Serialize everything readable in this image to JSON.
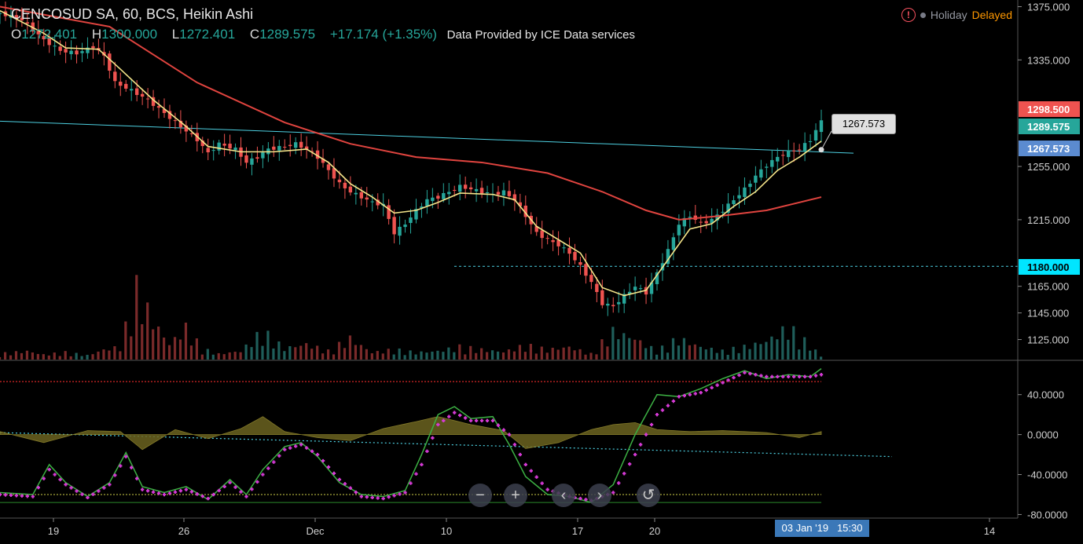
{
  "header": {
    "title": "CENCOSUD SA, 60, BCS, Heikin Ashi",
    "ohlc": [
      {
        "k": "O",
        "v": "1272.401"
      },
      {
        "k": "H",
        "v": "1300.000"
      },
      {
        "k": "L",
        "v": "1272.401"
      },
      {
        "k": "C",
        "v": "1289.575"
      }
    ],
    "change": "+17.174 (+1.35%)",
    "provider": "Data Provided by ICE Data services",
    "status_holiday": "Holiday",
    "status_delayed": "Delayed"
  },
  "tooltip": "1267.573",
  "crosshair_date": "03 Jan '19",
  "crosshair_time": "15:30",
  "controls": {
    "zoom_out": "−",
    "zoom_in": "+",
    "back": "‹",
    "forward": "›",
    "reset": "↺"
  },
  "colors": {
    "up": "#26a69a",
    "down": "#ef5350",
    "sma_fast": "#f5e58a",
    "sma_slow": "#e0443f",
    "trend": "#4dd0e1",
    "stoch_k": "#3cb043",
    "stoch_d": "#d63ad6",
    "histogram": "#6b6320"
  },
  "chart_data": [
    {
      "type": "candlestick",
      "title": "CENCOSUD SA, 60, BCS, Heikin Ashi",
      "x_ticks": [
        "19",
        "26",
        "Dec",
        "10",
        "17",
        "20",
        "14"
      ],
      "y_ticks": [
        "1375.000",
        "1335.000",
        "1255.000",
        "1215.000",
        "1165.000",
        "1145.000",
        "1125.000"
      ],
      "ylim": [
        1110,
        1380
      ],
      "price_labels": [
        {
          "value": "1298.500",
          "color": "#ef5350"
        },
        {
          "value": "1289.575",
          "color": "#26a69a"
        },
        {
          "value": "1267.573",
          "color": "#5b8bd0"
        },
        {
          "value": "1180.000",
          "color": "#00e5ff"
        }
      ],
      "horizontal_line": 1180,
      "trendline": {
        "from": 1289,
        "to": 1265
      },
      "price_path": [
        [
          0,
          1370
        ],
        [
          4,
          1365
        ],
        [
          8,
          1350
        ],
        [
          11,
          1342
        ],
        [
          14,
          1340
        ],
        [
          17,
          1345
        ],
        [
          19,
          1338
        ],
        [
          21,
          1318
        ],
        [
          24,
          1312
        ],
        [
          27,
          1305
        ],
        [
          30,
          1295
        ],
        [
          33,
          1285
        ],
        [
          36,
          1275
        ],
        [
          38,
          1265
        ],
        [
          40,
          1272
        ],
        [
          43,
          1268
        ],
        [
          45,
          1258
        ],
        [
          47,
          1262
        ],
        [
          49,
          1268
        ],
        [
          52,
          1270
        ],
        [
          54,
          1272
        ],
        [
          56,
          1268
        ],
        [
          58,
          1262
        ],
        [
          60,
          1252
        ],
        [
          62,
          1242
        ],
        [
          64,
          1236
        ],
        [
          66,
          1232
        ],
        [
          68,
          1228
        ],
        [
          70,
          1226
        ],
        [
          72,
          1205
        ],
        [
          74,
          1212
        ],
        [
          76,
          1222
        ],
        [
          78,
          1230
        ],
        [
          80,
          1232
        ],
        [
          82,
          1236
        ],
        [
          84,
          1240
        ],
        [
          86,
          1238
        ],
        [
          88,
          1236
        ],
        [
          90,
          1234
        ],
        [
          92,
          1236
        ],
        [
          94,
          1230
        ],
        [
          96,
          1218
        ],
        [
          98,
          1205
        ],
        [
          100,
          1200
        ],
        [
          102,
          1196
        ],
        [
          104,
          1190
        ],
        [
          106,
          1180
        ],
        [
          108,
          1168
        ],
        [
          110,
          1152
        ],
        [
          112,
          1150
        ],
        [
          114,
          1158
        ],
        [
          116,
          1165
        ],
        [
          118,
          1160
        ],
        [
          120,
          1175
        ],
        [
          122,
          1192
        ],
        [
          124,
          1212
        ],
        [
          126,
          1218
        ],
        [
          128,
          1212
        ],
        [
          130,
          1215
        ],
        [
          132,
          1222
        ],
        [
          134,
          1230
        ],
        [
          136,
          1238
        ],
        [
          138,
          1248
        ],
        [
          140,
          1256
        ],
        [
          142,
          1262
        ],
        [
          144,
          1266
        ],
        [
          146,
          1268
        ],
        [
          148,
          1275
        ],
        [
          150,
          1289
        ]
      ],
      "sma_fast": [
        [
          0,
          1372
        ],
        [
          8,
          1355
        ],
        [
          12,
          1344
        ],
        [
          18,
          1343
        ],
        [
          22,
          1328
        ],
        [
          28,
          1305
        ],
        [
          34,
          1285
        ],
        [
          38,
          1270
        ],
        [
          44,
          1266
        ],
        [
          50,
          1266
        ],
        [
          56,
          1268
        ],
        [
          60,
          1258
        ],
        [
          64,
          1242
        ],
        [
          68,
          1232
        ],
        [
          72,
          1220
        ],
        [
          76,
          1222
        ],
        [
          80,
          1228
        ],
        [
          84,
          1235
        ],
        [
          90,
          1234
        ],
        [
          94,
          1230
        ],
        [
          98,
          1210
        ],
        [
          102,
          1200
        ],
        [
          106,
          1190
        ],
        [
          110,
          1164
        ],
        [
          114,
          1158
        ],
        [
          118,
          1162
        ],
        [
          122,
          1185
        ],
        [
          126,
          1208
        ],
        [
          130,
          1212
        ],
        [
          134,
          1225
        ],
        [
          138,
          1236
        ],
        [
          142,
          1252
        ],
        [
          146,
          1262
        ],
        [
          150,
          1274
        ]
      ],
      "sma_slow": [
        [
          0,
          1375
        ],
        [
          20,
          1360
        ],
        [
          36,
          1318
        ],
        [
          52,
          1288
        ],
        [
          64,
          1272
        ],
        [
          76,
          1262
        ],
        [
          88,
          1258
        ],
        [
          100,
          1250
        ],
        [
          110,
          1236
        ],
        [
          118,
          1222
        ],
        [
          124,
          1215
        ],
        [
          132,
          1218
        ],
        [
          140,
          1222
        ],
        [
          150,
          1232
        ]
      ],
      "volume": [
        [
          0,
          0.08
        ],
        [
          5,
          0.12
        ],
        [
          8,
          0.07
        ],
        [
          12,
          0.1
        ],
        [
          16,
          0.06
        ],
        [
          19,
          0.14
        ],
        [
          22,
          0.18
        ],
        [
          25,
          1.0
        ],
        [
          28,
          0.55
        ],
        [
          31,
          0.22
        ],
        [
          34,
          0.45
        ],
        [
          37,
          0.15
        ],
        [
          40,
          0.08
        ],
        [
          44,
          0.12
        ],
        [
          48,
          0.4
        ],
        [
          52,
          0.16
        ],
        [
          56,
          0.22
        ],
        [
          60,
          0.12
        ],
        [
          64,
          0.3
        ],
        [
          68,
          0.1
        ],
        [
          72,
          0.14
        ],
        [
          76,
          0.1
        ],
        [
          80,
          0.12
        ],
        [
          84,
          0.18
        ],
        [
          88,
          0.14
        ],
        [
          92,
          0.11
        ],
        [
          96,
          0.2
        ],
        [
          100,
          0.14
        ],
        [
          104,
          0.18
        ],
        [
          108,
          0.08
        ],
        [
          112,
          0.4
        ],
        [
          116,
          0.3
        ],
        [
          120,
          0.12
        ],
        [
          124,
          0.3
        ],
        [
          128,
          0.18
        ],
        [
          132,
          0.12
        ],
        [
          136,
          0.18
        ],
        [
          140,
          0.26
        ],
        [
          144,
          0.46
        ],
        [
          148,
          0.2
        ],
        [
          150,
          0.05
        ]
      ]
    },
    {
      "type": "line",
      "title": "",
      "y_ticks": [
        "40.0000",
        "0.0000",
        "-40.0000",
        "-80.0000"
      ],
      "ylim": [
        -82,
        72
      ],
      "levels": {
        "upper": 53,
        "zero": 0,
        "lower": -60
      },
      "series": [
        {
          "values": [
            [
              0,
              -58
            ],
            [
              6,
              -60
            ],
            [
              9,
              -30
            ],
            [
              12,
              -48
            ],
            [
              16,
              -62
            ],
            [
              20,
              -48
            ],
            [
              23,
              -18
            ],
            [
              26,
              -52
            ],
            [
              30,
              -58
            ],
            [
              34,
              -52
            ],
            [
              38,
              -65
            ],
            [
              42,
              -45
            ],
            [
              45,
              -60
            ],
            [
              48,
              -35
            ],
            [
              52,
              -12
            ],
            [
              55,
              -8
            ],
            [
              58,
              -22
            ],
            [
              62,
              -48
            ],
            [
              66,
              -60
            ],
            [
              70,
              -62
            ],
            [
              74,
              -56
            ],
            [
              77,
              -20
            ],
            [
              80,
              20
            ],
            [
              83,
              28
            ],
            [
              86,
              16
            ],
            [
              90,
              18
            ],
            [
              93,
              -10
            ],
            [
              96,
              -42
            ],
            [
              100,
              -60
            ],
            [
              104,
              -62
            ],
            [
              108,
              -68
            ],
            [
              112,
              -50
            ],
            [
              116,
              0
            ],
            [
              120,
              40
            ],
            [
              124,
              38
            ],
            [
              128,
              46
            ],
            [
              132,
              56
            ],
            [
              136,
              64
            ],
            [
              140,
              56
            ],
            [
              144,
              60
            ],
            [
              148,
              58
            ],
            [
              150,
              66
            ]
          ]
        },
        {
          "values": [
            [
              0,
              -60
            ],
            [
              6,
              -62
            ],
            [
              9,
              -35
            ],
            [
              12,
              -50
            ],
            [
              16,
              -63
            ],
            [
              20,
              -50
            ],
            [
              23,
              -22
            ],
            [
              26,
              -55
            ],
            [
              30,
              -60
            ],
            [
              34,
              -55
            ],
            [
              38,
              -64
            ],
            [
              42,
              -48
            ],
            [
              45,
              -62
            ],
            [
              48,
              -40
            ],
            [
              52,
              -15
            ],
            [
              55,
              -10
            ],
            [
              58,
              -20
            ],
            [
              62,
              -45
            ],
            [
              66,
              -62
            ],
            [
              70,
              -64
            ],
            [
              74,
              -58
            ],
            [
              77,
              -30
            ],
            [
              80,
              10
            ],
            [
              83,
              22
            ],
            [
              86,
              14
            ],
            [
              90,
              14
            ],
            [
              93,
              0
            ],
            [
              96,
              -30
            ],
            [
              100,
              -55
            ],
            [
              104,
              -62
            ],
            [
              108,
              -66
            ],
            [
              112,
              -58
            ],
            [
              116,
              -20
            ],
            [
              120,
              20
            ],
            [
              124,
              38
            ],
            [
              128,
              42
            ],
            [
              132,
              52
            ],
            [
              136,
              62
            ],
            [
              140,
              58
            ],
            [
              144,
              58
            ],
            [
              148,
              58
            ],
            [
              150,
              60
            ]
          ]
        }
      ],
      "histogram": [
        [
          0,
          3
        ],
        [
          8,
          -8
        ],
        [
          16,
          4
        ],
        [
          22,
          3
        ],
        [
          26,
          -15
        ],
        [
          32,
          5
        ],
        [
          38,
          -4
        ],
        [
          44,
          6
        ],
        [
          48,
          18
        ],
        [
          52,
          3
        ],
        [
          58,
          -3
        ],
        [
          64,
          -6
        ],
        [
          70,
          6
        ],
        [
          76,
          13
        ],
        [
          80,
          18
        ],
        [
          86,
          10
        ],
        [
          92,
          4
        ],
        [
          96,
          -14
        ],
        [
          102,
          -8
        ],
        [
          108,
          5
        ],
        [
          112,
          10
        ],
        [
          116,
          12
        ],
        [
          120,
          5
        ],
        [
          126,
          3
        ],
        [
          132,
          4
        ],
        [
          140,
          2
        ],
        [
          146,
          -3
        ],
        [
          150,
          3
        ]
      ],
      "trend": {
        "from": 2,
        "to": -22
      }
    }
  ]
}
